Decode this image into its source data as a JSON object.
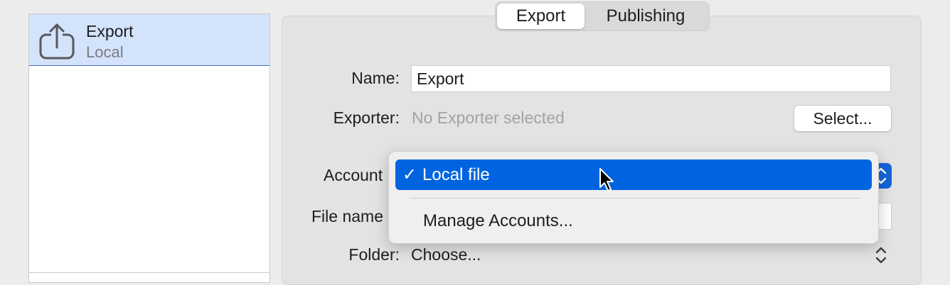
{
  "sidebar": {
    "items": [
      {
        "title": "Export",
        "subtitle": "Local",
        "icon": "share-export-icon",
        "selected": true
      }
    ]
  },
  "tabs": [
    {
      "label": "Export",
      "selected": true
    },
    {
      "label": "Publishing",
      "selected": false
    }
  ],
  "form": {
    "name_label": "Name:",
    "name_value": "Export",
    "exporter_label": "Exporter:",
    "exporter_value": "No Exporter selected",
    "select_button": "Select...",
    "account_label": "Account",
    "file_name_label": "File name",
    "folder_label": "Folder:",
    "folder_value": "Choose..."
  },
  "account_menu": {
    "selected_item": {
      "check": "✓",
      "label": "Local file"
    },
    "items": [
      {
        "label": "Manage Accounts..."
      }
    ]
  },
  "colors": {
    "accent": "#0064e0",
    "selection_row": "#d3e3fb",
    "placeholder_text": "#a3a3a6"
  }
}
